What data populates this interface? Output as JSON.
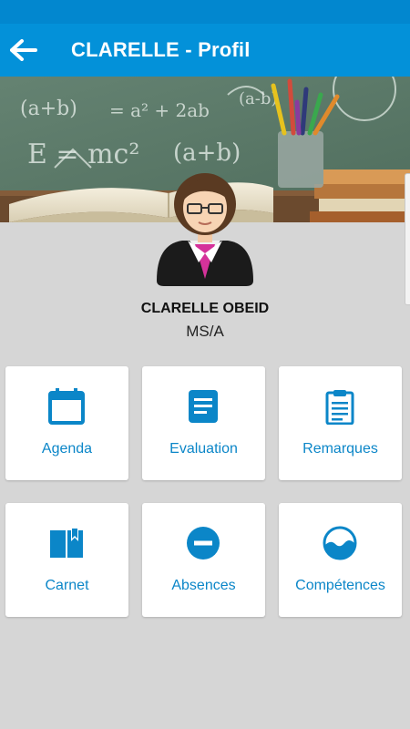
{
  "appbar": {
    "title": "CLARELLE - Profil",
    "back_icon": "arrow-left-icon"
  },
  "banner": {
    "chalk_formulas": [
      "(a+b)",
      "= a² + 2ab",
      "E = mc²",
      "(a+b)",
      "(a-b)"
    ]
  },
  "profile": {
    "name": "CLARELLE OBEID",
    "class": "MS/A",
    "avatar_icon": "teacher-avatar-icon"
  },
  "tiles": [
    {
      "label": "Agenda",
      "icon": "calendar-icon"
    },
    {
      "label": "Evaluation",
      "icon": "document-icon"
    },
    {
      "label": "Remarques",
      "icon": "clipboard-icon"
    },
    {
      "label": "Carnet",
      "icon": "book-icon"
    },
    {
      "label": "Absences",
      "icon": "minus-circle-icon"
    },
    {
      "label": "Compétences",
      "icon": "water-level-icon"
    }
  ],
  "colors": {
    "appbar": "#0391d9",
    "statusbar": "#0287cf",
    "accent": "#0b86c8",
    "background": "#d6d6d6"
  }
}
